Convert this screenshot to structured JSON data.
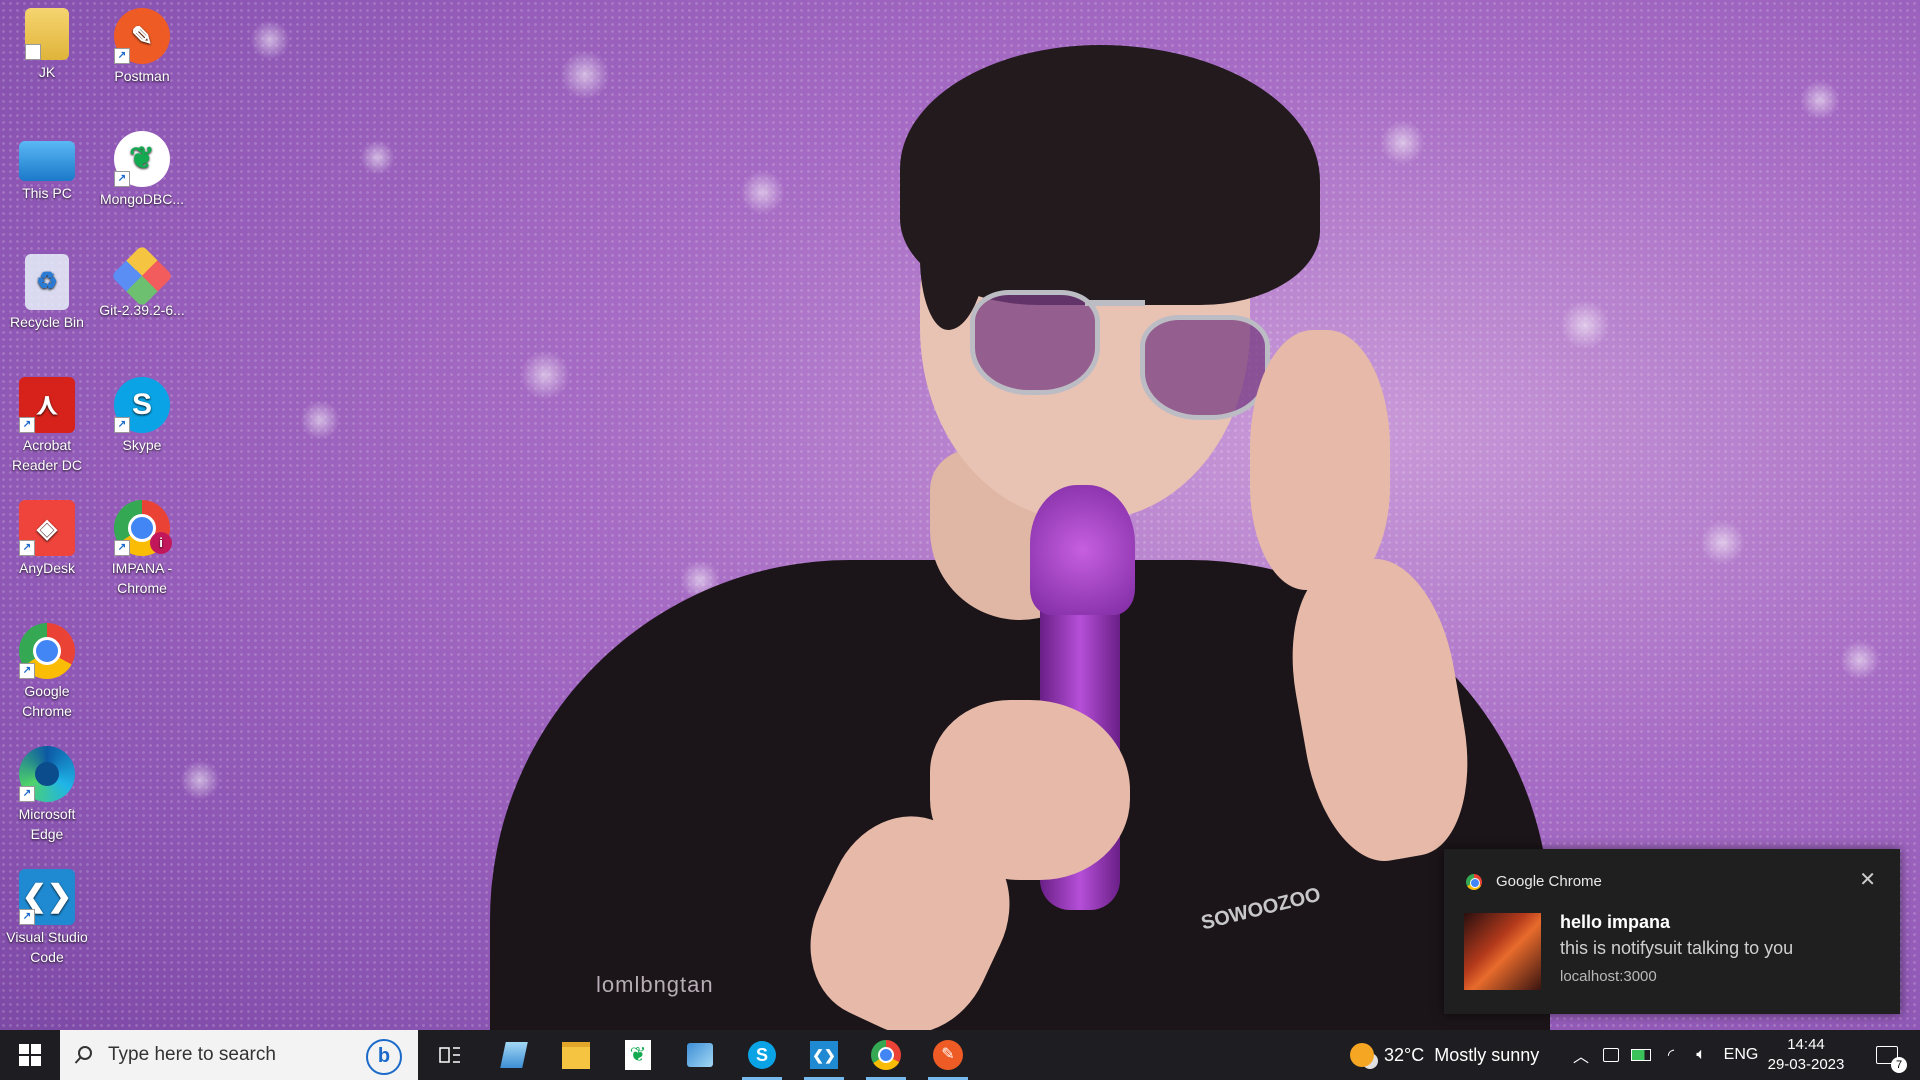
{
  "desktop_icons": [
    {
      "label": "JK"
    },
    {
      "label": "Postman"
    },
    {
      "label": "This PC"
    },
    {
      "label": "MongoDBC..."
    },
    {
      "label": "Recycle Bin"
    },
    {
      "label": "Git-2.39.2-6..."
    },
    {
      "label": "Acrobat Reader DC"
    },
    {
      "label": "Skype"
    },
    {
      "label": "AnyDesk"
    },
    {
      "label": "IMPANA - Chrome"
    },
    {
      "label": "Google Chrome"
    },
    {
      "label": "Microsoft Edge"
    },
    {
      "label": "Visual Studio Code"
    }
  ],
  "wallpaper": {
    "watermark": "lomlbngtan",
    "shirt_text": "SOWOOZOO"
  },
  "notification": {
    "app": "Google Chrome",
    "title": "hello impana",
    "body": "this is notifysuit talking to you",
    "source": "localhost:3000",
    "close_glyph": "✕"
  },
  "taskbar": {
    "search_placeholder": "Type here to search",
    "weather_temp": "32°C",
    "weather_desc": "Mostly sunny",
    "language": "ENG",
    "time": "14:44",
    "date": "29-03-2023",
    "notification_count": "7",
    "colors": {
      "bar": "#1e1e22",
      "active_underline": "#76b9ed"
    }
  }
}
